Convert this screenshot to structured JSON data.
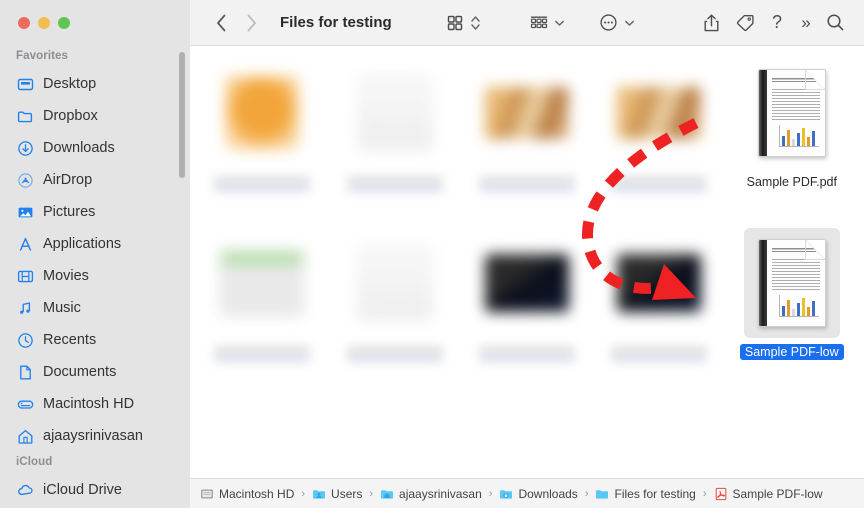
{
  "window": {
    "title": "Files for testing",
    "traffic_lights": [
      {
        "name": "close",
        "color": "#ec6a5f"
      },
      {
        "name": "minimize",
        "color": "#f5bd4f"
      },
      {
        "name": "maximize",
        "color": "#61c554"
      }
    ]
  },
  "toolbar": {
    "back_label": "‹",
    "forward_label": "›",
    "title": "Files for testing",
    "icons": [
      {
        "name": "icon-view-grid-icon",
        "label": "grid-view"
      },
      {
        "name": "view-switch-caret",
        "label": "⌃⌄"
      },
      {
        "name": "group-by-icon",
        "label": "group-by"
      },
      {
        "name": "group-caret",
        "label": "chevron-down"
      },
      {
        "name": "more-options-icon",
        "label": "more"
      },
      {
        "name": "more-caret",
        "label": "chevron-down"
      },
      {
        "name": "share-icon",
        "label": "share"
      },
      {
        "name": "tag-icon",
        "label": "tag"
      },
      {
        "name": "help-icon",
        "label": "?"
      },
      {
        "name": "overflow-icon",
        "label": "»"
      },
      {
        "name": "search-icon",
        "label": "search"
      }
    ]
  },
  "sidebar": {
    "sections": [
      {
        "title": "Favorites",
        "items": [
          {
            "label": "Desktop",
            "icon": "desktop-icon"
          },
          {
            "label": "Dropbox",
            "icon": "folder-icon"
          },
          {
            "label": "Downloads",
            "icon": "downloads-icon"
          },
          {
            "label": "AirDrop",
            "icon": "airdrop-icon"
          },
          {
            "label": "Pictures",
            "icon": "pictures-icon"
          },
          {
            "label": "Applications",
            "icon": "applications-icon"
          },
          {
            "label": "Movies",
            "icon": "movies-icon"
          },
          {
            "label": "Music",
            "icon": "music-icon"
          },
          {
            "label": "Recents",
            "icon": "recents-clock-icon"
          },
          {
            "label": "Documents",
            "icon": "document-icon"
          },
          {
            "label": "Macintosh HD",
            "icon": "harddisk-icon"
          },
          {
            "label": "ajaaysrinivasan",
            "icon": "home-icon"
          }
        ]
      },
      {
        "title": "iCloud",
        "items": [
          {
            "label": "iCloud Drive",
            "icon": "icloud-icon"
          }
        ]
      }
    ]
  },
  "files": {
    "row1": [
      {
        "name": "",
        "blurred": true,
        "thumb": "orange"
      },
      {
        "name": "",
        "blurred": true,
        "thumb": "doc"
      },
      {
        "name": "",
        "blurred": true,
        "thumb": "photo"
      },
      {
        "name": "",
        "blurred": true,
        "thumb": "photo"
      },
      {
        "name": "Sample PDF.pdf",
        "blurred": false,
        "thumb": "pdf",
        "selected": false
      }
    ],
    "row2": [
      {
        "name": "",
        "blurred": true,
        "thumb": "green"
      },
      {
        "name": "",
        "blurred": true,
        "thumb": "doc"
      },
      {
        "name": "",
        "blurred": true,
        "thumb": "dark"
      },
      {
        "name": "",
        "blurred": true,
        "thumb": "dark"
      },
      {
        "name": "Sample PDF-low",
        "blurred": false,
        "thumb": "pdf",
        "selected": true
      }
    ]
  },
  "annotation": {
    "type": "curved-dashed-arrow",
    "color": "#ee2222",
    "description": "red dashed arrow pointing from Sample PDF.pdf down to Sample PDF-low"
  },
  "pathbar": {
    "items": [
      {
        "label": "Macintosh HD",
        "icon": "harddisk-icon"
      },
      {
        "label": "Users",
        "icon": "users-folder-icon"
      },
      {
        "label": "ajaaysrinivasan",
        "icon": "home-folder-icon"
      },
      {
        "label": "Downloads",
        "icon": "downloads-folder-icon"
      },
      {
        "label": "Files for testing",
        "icon": "folder-icon"
      },
      {
        "label": "Sample PDF-low",
        "icon": "pdf-file-icon"
      }
    ],
    "separator": "›"
  },
  "colors": {
    "sidebar_bg": "#e4e4e4",
    "toolbar_bg": "#f2f2f2",
    "accent_blue": "#1a6ef0",
    "icon_blue": "#1f82f0",
    "annotation_red": "#ee2222"
  }
}
